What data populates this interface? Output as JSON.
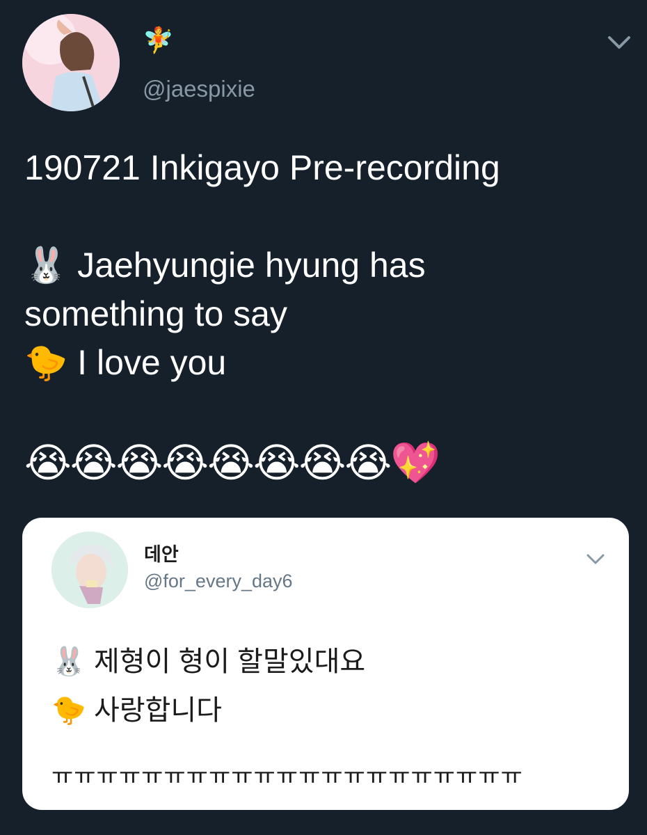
{
  "author": {
    "display_name": "🧚",
    "handle": "@jaespixie"
  },
  "tweet": {
    "line1": "190721 Inkigayo Pre-recording",
    "line2_emoji": "🐰",
    "line2_text": "Jaehyungie hyung has",
    "line3_text": "something to say",
    "line4_emoji": "🐤",
    "line4_text": "I love you",
    "reaction_emojis": "😭😭😭😭😭😭😭😭💖"
  },
  "quoted_tweet": {
    "display_name": "데안",
    "handle": "@for_every_day6",
    "line1_emoji": "🐰",
    "line1_text": "제형이 형이 할말있대요",
    "line2_emoji": "🐤",
    "line2_text": "사랑합니다",
    "line3_text": "ㅠㅠㅠㅠㅠㅠㅠㅠㅠㅠㅠㅠㅠㅠㅠㅠㅠㅠㅠㅠㅠ"
  },
  "colors": {
    "background": "#15202b",
    "secondary_text": "#8899a6",
    "quote_background": "#ffffff"
  },
  "icons": {
    "more_menu": "chevron-down-icon"
  }
}
